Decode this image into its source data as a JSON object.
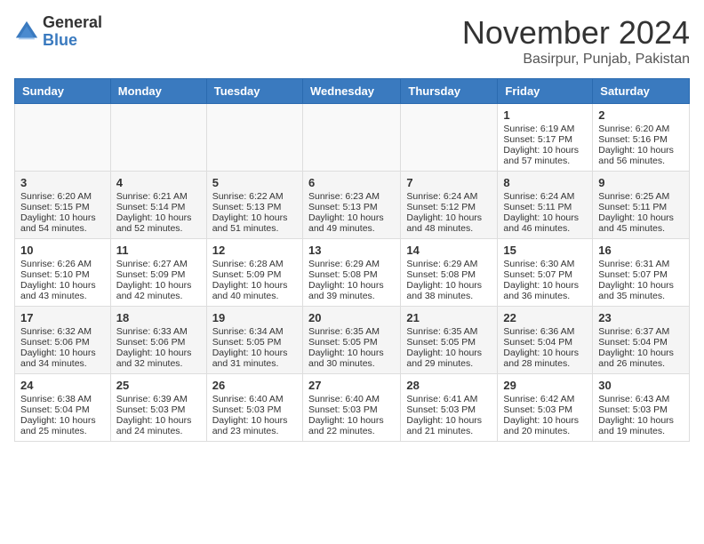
{
  "header": {
    "logo_general": "General",
    "logo_blue": "Blue",
    "month": "November 2024",
    "location": "Basirpur, Punjab, Pakistan"
  },
  "weekdays": [
    "Sunday",
    "Monday",
    "Tuesday",
    "Wednesday",
    "Thursday",
    "Friday",
    "Saturday"
  ],
  "weeks": [
    [
      {
        "day": "",
        "content": ""
      },
      {
        "day": "",
        "content": ""
      },
      {
        "day": "",
        "content": ""
      },
      {
        "day": "",
        "content": ""
      },
      {
        "day": "",
        "content": ""
      },
      {
        "day": "1",
        "content": "Sunrise: 6:19 AM\nSunset: 5:17 PM\nDaylight: 10 hours and 57 minutes."
      },
      {
        "day": "2",
        "content": "Sunrise: 6:20 AM\nSunset: 5:16 PM\nDaylight: 10 hours and 56 minutes."
      }
    ],
    [
      {
        "day": "3",
        "content": "Sunrise: 6:20 AM\nSunset: 5:15 PM\nDaylight: 10 hours and 54 minutes."
      },
      {
        "day": "4",
        "content": "Sunrise: 6:21 AM\nSunset: 5:14 PM\nDaylight: 10 hours and 52 minutes."
      },
      {
        "day": "5",
        "content": "Sunrise: 6:22 AM\nSunset: 5:13 PM\nDaylight: 10 hours and 51 minutes."
      },
      {
        "day": "6",
        "content": "Sunrise: 6:23 AM\nSunset: 5:13 PM\nDaylight: 10 hours and 49 minutes."
      },
      {
        "day": "7",
        "content": "Sunrise: 6:24 AM\nSunset: 5:12 PM\nDaylight: 10 hours and 48 minutes."
      },
      {
        "day": "8",
        "content": "Sunrise: 6:24 AM\nSunset: 5:11 PM\nDaylight: 10 hours and 46 minutes."
      },
      {
        "day": "9",
        "content": "Sunrise: 6:25 AM\nSunset: 5:11 PM\nDaylight: 10 hours and 45 minutes."
      }
    ],
    [
      {
        "day": "10",
        "content": "Sunrise: 6:26 AM\nSunset: 5:10 PM\nDaylight: 10 hours and 43 minutes."
      },
      {
        "day": "11",
        "content": "Sunrise: 6:27 AM\nSunset: 5:09 PM\nDaylight: 10 hours and 42 minutes."
      },
      {
        "day": "12",
        "content": "Sunrise: 6:28 AM\nSunset: 5:09 PM\nDaylight: 10 hours and 40 minutes."
      },
      {
        "day": "13",
        "content": "Sunrise: 6:29 AM\nSunset: 5:08 PM\nDaylight: 10 hours and 39 minutes."
      },
      {
        "day": "14",
        "content": "Sunrise: 6:29 AM\nSunset: 5:08 PM\nDaylight: 10 hours and 38 minutes."
      },
      {
        "day": "15",
        "content": "Sunrise: 6:30 AM\nSunset: 5:07 PM\nDaylight: 10 hours and 36 minutes."
      },
      {
        "day": "16",
        "content": "Sunrise: 6:31 AM\nSunset: 5:07 PM\nDaylight: 10 hours and 35 minutes."
      }
    ],
    [
      {
        "day": "17",
        "content": "Sunrise: 6:32 AM\nSunset: 5:06 PM\nDaylight: 10 hours and 34 minutes."
      },
      {
        "day": "18",
        "content": "Sunrise: 6:33 AM\nSunset: 5:06 PM\nDaylight: 10 hours and 32 minutes."
      },
      {
        "day": "19",
        "content": "Sunrise: 6:34 AM\nSunset: 5:05 PM\nDaylight: 10 hours and 31 minutes."
      },
      {
        "day": "20",
        "content": "Sunrise: 6:35 AM\nSunset: 5:05 PM\nDaylight: 10 hours and 30 minutes."
      },
      {
        "day": "21",
        "content": "Sunrise: 6:35 AM\nSunset: 5:05 PM\nDaylight: 10 hours and 29 minutes."
      },
      {
        "day": "22",
        "content": "Sunrise: 6:36 AM\nSunset: 5:04 PM\nDaylight: 10 hours and 28 minutes."
      },
      {
        "day": "23",
        "content": "Sunrise: 6:37 AM\nSunset: 5:04 PM\nDaylight: 10 hours and 26 minutes."
      }
    ],
    [
      {
        "day": "24",
        "content": "Sunrise: 6:38 AM\nSunset: 5:04 PM\nDaylight: 10 hours and 25 minutes."
      },
      {
        "day": "25",
        "content": "Sunrise: 6:39 AM\nSunset: 5:03 PM\nDaylight: 10 hours and 24 minutes."
      },
      {
        "day": "26",
        "content": "Sunrise: 6:40 AM\nSunset: 5:03 PM\nDaylight: 10 hours and 23 minutes."
      },
      {
        "day": "27",
        "content": "Sunrise: 6:40 AM\nSunset: 5:03 PM\nDaylight: 10 hours and 22 minutes."
      },
      {
        "day": "28",
        "content": "Sunrise: 6:41 AM\nSunset: 5:03 PM\nDaylight: 10 hours and 21 minutes."
      },
      {
        "day": "29",
        "content": "Sunrise: 6:42 AM\nSunset: 5:03 PM\nDaylight: 10 hours and 20 minutes."
      },
      {
        "day": "30",
        "content": "Sunrise: 6:43 AM\nSunset: 5:03 PM\nDaylight: 10 hours and 19 minutes."
      }
    ]
  ]
}
